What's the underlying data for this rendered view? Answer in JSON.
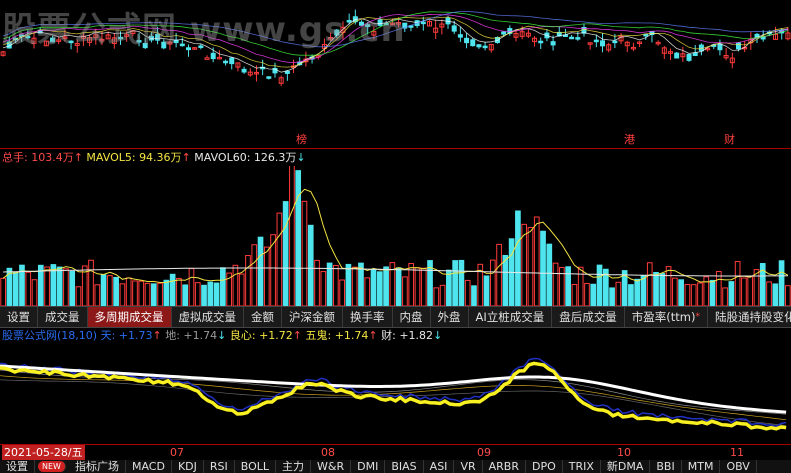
{
  "watermark": "股票公式网 www.gs.cn",
  "event_marks": [
    {
      "label": "榜"
    },
    {
      "label": "港"
    },
    {
      "label": "财"
    }
  ],
  "volume_header": {
    "total_label": "总手: ",
    "total_value": "103.4万",
    "total_arrow": "↑",
    "mavol5_label": "MAVOL5: ",
    "mavol5_value": "94.36万",
    "mavol5_arrow": "↑",
    "mavol60_label": "MAVOL60: ",
    "mavol60_value": "126.3万",
    "mavol60_arrow": "↓"
  },
  "tabs": [
    {
      "label": "设置",
      "active": false
    },
    {
      "label": "成交量",
      "active": false
    },
    {
      "label": "多周期成交量",
      "active": true
    },
    {
      "label": "虚拟成交量",
      "active": false
    },
    {
      "label": "金额",
      "active": false
    },
    {
      "label": "沪深金额",
      "active": false
    },
    {
      "label": "换手率",
      "active": false
    },
    {
      "label": "内盘",
      "active": false
    },
    {
      "label": "外盘",
      "active": false
    },
    {
      "label": "AI立桩成交量",
      "active": false
    },
    {
      "label": "盘后成交量",
      "active": false
    },
    {
      "label": "市盈率(ttm)",
      "active": false,
      "star": "*"
    },
    {
      "label": "陆股通持股变化",
      "active": false
    }
  ],
  "indicator_header": {
    "name": "股票公式网(18,10) 天: ",
    "tian_value": "+1.73",
    "tian_arrow": "↑",
    "di_label": " 地: ",
    "di_value": "+1.74",
    "di_arrow": "↓",
    "liangxin_label": " 良心: ",
    "liangxin_value": "+1.72",
    "liangxin_arrow": "↑",
    "wugui_label": " 五鬼: ",
    "wugui_value": "+1.74",
    "wugui_arrow": "↑",
    "cai_label": " 财: ",
    "cai_value": "+1.82",
    "cai_arrow": "↓"
  },
  "date_axis": {
    "selected_date": "2021-05-28/五",
    "months": [
      {
        "label": "07"
      },
      {
        "label": "08"
      },
      {
        "label": "09"
      },
      {
        "label": "10"
      },
      {
        "label": "11"
      }
    ]
  },
  "bottom_tabs": [
    {
      "label": "设置",
      "type": "tab"
    },
    {
      "label": "NEW",
      "type": "badge"
    },
    {
      "label": "指标广场",
      "type": "tab"
    },
    {
      "label": "MACD",
      "type": "tab"
    },
    {
      "label": "KDJ",
      "type": "tab"
    },
    {
      "label": "RSI",
      "type": "tab"
    },
    {
      "label": "BOLL",
      "type": "tab"
    },
    {
      "label": "主力",
      "type": "tab"
    },
    {
      "label": "W&R",
      "type": "tab"
    },
    {
      "label": "DMI",
      "type": "tab"
    },
    {
      "label": "BIAS",
      "type": "tab"
    },
    {
      "label": "ASI",
      "type": "tab"
    },
    {
      "label": "VR",
      "type": "tab"
    },
    {
      "label": "ARBR",
      "type": "tab"
    },
    {
      "label": "DPO",
      "type": "tab"
    },
    {
      "label": "TRIX",
      "type": "tab"
    },
    {
      "label": "新DMA",
      "type": "tab"
    },
    {
      "label": "BBI",
      "type": "tab"
    },
    {
      "label": "MTM",
      "type": "tab"
    },
    {
      "label": "OBV",
      "type": "tab"
    }
  ],
  "colors": {
    "background": "#000000",
    "up": "#ff3b3b",
    "down": "#4ee5ee",
    "mavol5": "#f4e542",
    "mavol60": "#e8e8e8",
    "line_tian": "#ffffff",
    "line_yellow": "#f8f020",
    "line_blue": "#2030c0",
    "active_tab": "#8c1818"
  }
}
